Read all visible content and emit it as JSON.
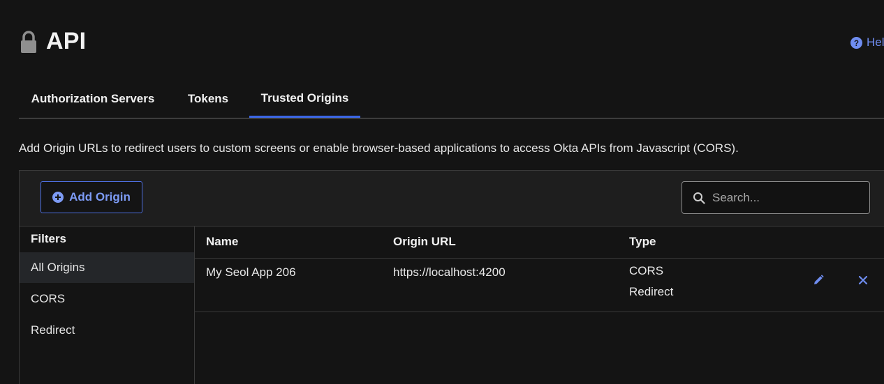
{
  "header": {
    "title": "API",
    "help_label": "Help"
  },
  "tabs": [
    {
      "label": "Authorization Servers"
    },
    {
      "label": "Tokens"
    },
    {
      "label": "Trusted Origins"
    }
  ],
  "active_tab": "Trusted Origins",
  "description": "Add Origin URLs to redirect users to custom screens or enable browser-based applications to access Okta APIs from Javascript (CORS).",
  "toolbar": {
    "add_button_label": "Add Origin",
    "search_placeholder": "Search..."
  },
  "filters": {
    "heading": "Filters",
    "items": [
      {
        "label": "All Origins"
      },
      {
        "label": "CORS"
      },
      {
        "label": "Redirect"
      }
    ],
    "selected": "All Origins"
  },
  "table": {
    "columns": [
      "Name",
      "Origin URL",
      "Type"
    ],
    "rows": [
      {
        "name": "My Seol App 206",
        "origin_url": "https://localhost:4200",
        "types": [
          "CORS",
          "Redirect"
        ]
      }
    ]
  },
  "colors": {
    "accent": "#3b66e6",
    "link": "#6f8df0",
    "background": "#141414"
  },
  "icons": [
    "lock-icon",
    "help-icon",
    "plus-circle-icon",
    "search-icon",
    "edit-icon",
    "close-icon"
  ]
}
